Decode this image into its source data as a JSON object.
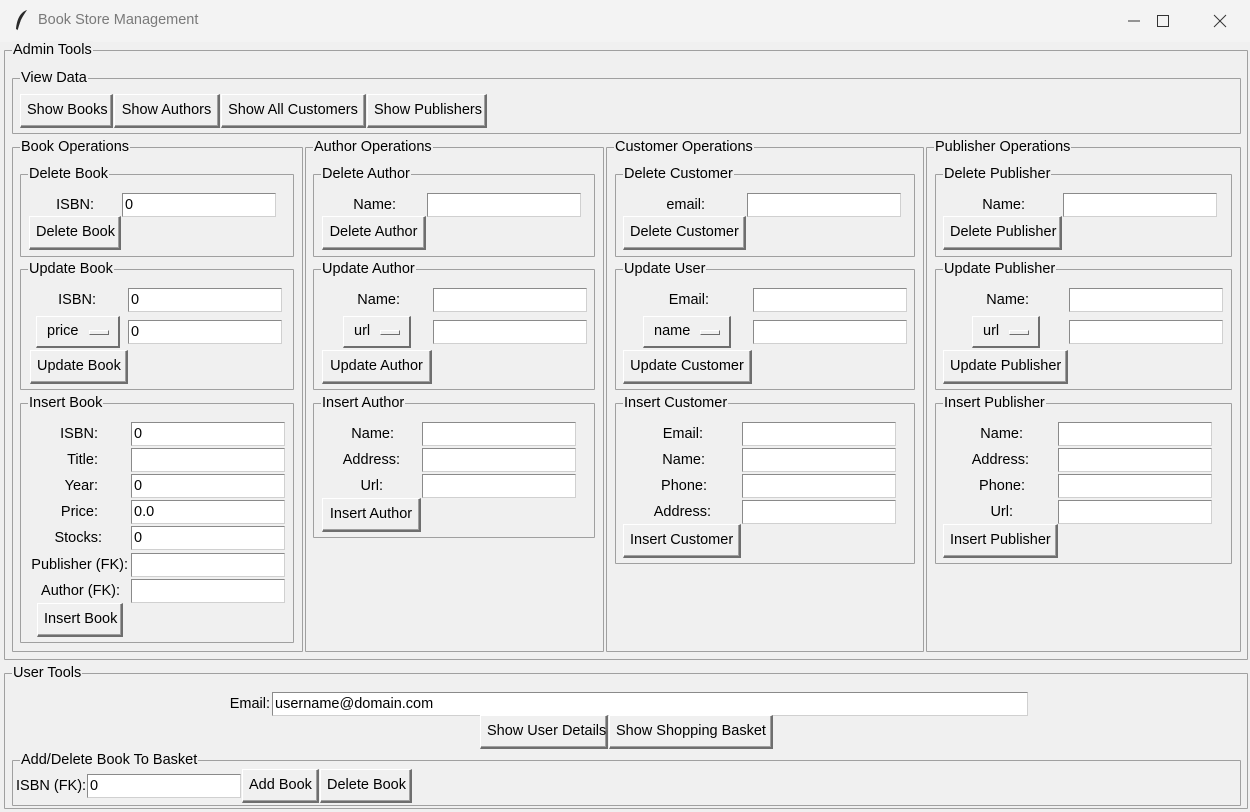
{
  "window": {
    "title": "Book Store Management"
  },
  "admin": {
    "title": "Admin Tools",
    "view": {
      "title": "View Data",
      "show_books": "Show Books",
      "show_authors": "Show Authors",
      "show_customers": "Show All Customers",
      "show_publishers": "Show Publishers"
    },
    "book": {
      "title": "Book Operations",
      "del": {
        "title": "Delete Book",
        "isbn_label": "ISBN:",
        "isbn_value": "0",
        "button": "Delete Book"
      },
      "upd": {
        "title": "Update Book",
        "isbn_label": "ISBN:",
        "isbn_value": "0",
        "field": "price",
        "new_value": "0",
        "button": "Update Book"
      },
      "ins": {
        "title": "Insert Book",
        "isbn_label": "ISBN:",
        "isbn_value": "0",
        "title_label": "Title:",
        "title_value": "",
        "year_label": "Year:",
        "year_value": "0",
        "price_label": "Price:",
        "price_value": "0.0",
        "stocks_label": "Stocks:",
        "stocks_value": "0",
        "publisher_label": "Publisher (FK):",
        "publisher_value": "",
        "author_label": "Author (FK):",
        "author_value": "",
        "button": "Insert Book"
      }
    },
    "author": {
      "title": "Author Operations",
      "del": {
        "title": "Delete Author",
        "name_label": "Name:",
        "name_value": "",
        "button": "Delete Author"
      },
      "upd": {
        "title": "Update Author",
        "name_label": "Name:",
        "name_value": "",
        "field": "url",
        "new_value": "",
        "button": "Update Author"
      },
      "ins": {
        "title": "Insert Author",
        "name_label": "Name:",
        "name_value": "",
        "address_label": "Address:",
        "address_value": "",
        "url_label": "Url:",
        "url_value": "",
        "button": "Insert Author"
      }
    },
    "customer": {
      "title": "Customer Operations",
      "del": {
        "title": "Delete Customer",
        "email_label": "email:",
        "email_value": "",
        "button": "Delete Customer"
      },
      "upd": {
        "title": "Update User",
        "email_label": "Email:",
        "email_value": "",
        "field": "name",
        "new_value": "",
        "button": "Update Customer"
      },
      "ins": {
        "title": "Insert Customer",
        "email_label": "Email:",
        "email_value": "",
        "name_label": "Name:",
        "name_value": "",
        "phone_label": "Phone:",
        "phone_value": "",
        "address_label": "Address:",
        "address_value": "",
        "button": "Insert Customer"
      }
    },
    "publisher": {
      "title": "Publisher Operations",
      "del": {
        "title": "Delete Publisher",
        "name_label": "Name:",
        "name_value": "",
        "button": "Delete Publisher"
      },
      "upd": {
        "title": "Update Publisher",
        "name_label": "Name:",
        "name_value": "",
        "field": "url",
        "new_value": "",
        "button": "Update Publisher"
      },
      "ins": {
        "title": "Insert Publisher",
        "name_label": "Name:",
        "name_value": "",
        "address_label": "Address:",
        "address_value": "",
        "phone_label": "Phone:",
        "phone_value": "",
        "url_label": "Url:",
        "url_value": "",
        "button": "Insert Publisher"
      }
    }
  },
  "user": {
    "title": "User Tools",
    "email_label": "Email:",
    "email_value": "username@domain.com",
    "show_details": "Show User Details",
    "show_basket": "Show Shopping Basket",
    "basket": {
      "title": "Add/Delete Book To Basket",
      "isbn_label": "ISBN (FK):",
      "isbn_value": "0",
      "add": "Add Book",
      "delete": "Delete Book"
    }
  }
}
